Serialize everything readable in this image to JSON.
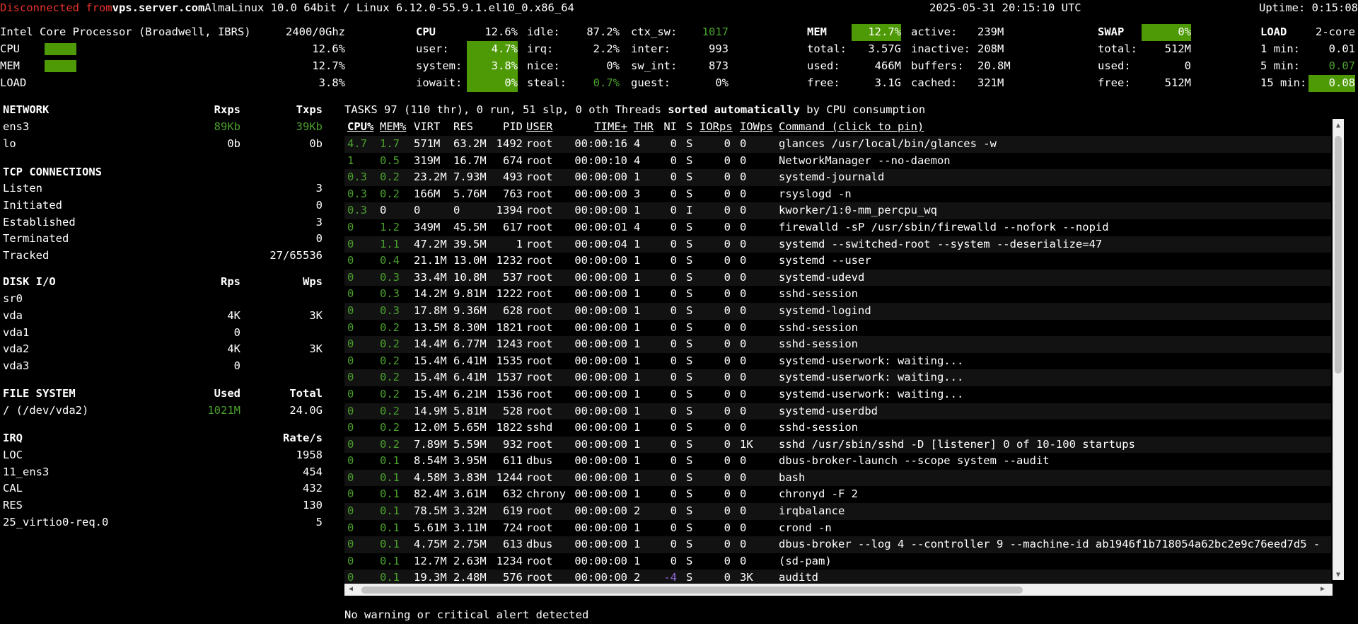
{
  "colors": {
    "accent_green": "#4e9a06",
    "text_green": "#4aa02c",
    "warn_red": "#e8342b",
    "nice_purple": "#8d6bd6",
    "background": "#000000"
  },
  "header": {
    "disconnected": "Disconnected from",
    "host": "vps.server.com",
    "os": "AlmaLinux 10.0 64bit / Linux 6.12.0-55.9.1.el10_0.x86_64",
    "datetime": "2025-05-31 20:15:10 UTC",
    "uptime": "Uptime: 0:15:08"
  },
  "quicklook": {
    "cpu_name": "Intel Core Processor (Broadwell, IBRS)",
    "freq": "2400/0Ghz",
    "cpu_label": "CPU",
    "cpu_pct": "12.6%",
    "cpu_fill": 0.126,
    "mem_label": "MEM",
    "mem_pct": "12.7%",
    "mem_fill": 0.127,
    "load_label": "LOAD",
    "load_pct": "3.8%"
  },
  "cpu": {
    "title": "CPU",
    "total": "12.6%",
    "user_l": "user:",
    "user": "4.7%",
    "system_l": "system:",
    "system": "3.8%",
    "iowait_l": "iowait:",
    "iowait": "0%",
    "idle_l": "idle:",
    "idle": "87.2%",
    "irq_l": "irq:",
    "irq": "2.2%",
    "nice_l": "nice:",
    "nice": "0%",
    "steal_l": "steal:",
    "steal": "0.7%",
    "ctx_l": "ctx_sw:",
    "ctx": "1017",
    "inter_l": "inter:",
    "inter": "993",
    "swint_l": "sw_int:",
    "swint": "873",
    "guest_l": "guest:",
    "guest": "0%"
  },
  "mem": {
    "title": "MEM",
    "pct": "12.7%",
    "total_l": "total:",
    "total": "3.57G",
    "used_l": "used:",
    "used": "466M",
    "free_l": "free:",
    "free": "3.1G",
    "active_l": "active:",
    "active": "239M",
    "inactive_l": "inactive:",
    "inactive": "208M",
    "buffers_l": "buffers:",
    "buffers": "20.8M",
    "cached_l": "cached:",
    "cached": "321M"
  },
  "swap": {
    "title": "SWAP",
    "pct": "0%",
    "total_l": "total:",
    "total": "512M",
    "used_l": "used:",
    "used": "0",
    "free_l": "free:",
    "free": "512M"
  },
  "load": {
    "title": "LOAD",
    "cores": "2-core",
    "m1_l": "1 min:",
    "m1": "0.01",
    "m5_l": "5 min:",
    "m5": "0.07",
    "m15_l": "15 min:",
    "m15": "0.08"
  },
  "network": {
    "title": "NETWORK",
    "rx": "Rxps",
    "tx": "Txps",
    "rows": [
      {
        "name": "ens3",
        "rx": "89Kb",
        "tx": "39Kb"
      },
      {
        "name": "lo",
        "rx": "0b",
        "tx": "0b"
      }
    ]
  },
  "tcp": {
    "title": "TCP CONNECTIONS",
    "rows": [
      {
        "name": "Listen",
        "value": "3"
      },
      {
        "name": "Initiated",
        "value": "0"
      },
      {
        "name": "Established",
        "value": "3"
      },
      {
        "name": "Terminated",
        "value": "0"
      },
      {
        "name": "Tracked",
        "value": "27/65536"
      }
    ]
  },
  "diskio": {
    "title": "DISK I/O",
    "rps": "Rps",
    "wps": "Wps",
    "rows": [
      {
        "name": "sr0",
        "r": "",
        "w": ""
      },
      {
        "name": "vda",
        "r": "4K",
        "w": "3K"
      },
      {
        "name": "vda1",
        "r": "0",
        "w": ""
      },
      {
        "name": "vda2",
        "r": "4K",
        "w": "3K"
      },
      {
        "name": "vda3",
        "r": "0",
        "w": ""
      }
    ]
  },
  "fs": {
    "title": "FILE SYSTEM",
    "used": "Used",
    "total": "Total",
    "rows": [
      {
        "name": "/ (/dev/vda2)",
        "used": "1021M",
        "total": "24.0G"
      }
    ]
  },
  "irq": {
    "title": "IRQ",
    "rate": "Rate/s",
    "rows": [
      {
        "name": "LOC",
        "value": "1958"
      },
      {
        "name": "11_ens3",
        "value": "454"
      },
      {
        "name": "CAL",
        "value": "432"
      },
      {
        "name": "RES",
        "value": "130"
      },
      {
        "name": "25_virtio0-req.0",
        "value": "5"
      }
    ]
  },
  "tasks": {
    "prefix": "TASKS 97 (110 thr), 0 run, 51 slp, 0 oth Threads ",
    "sorted": "sorted automatically",
    "suffix": " by CPU consumption"
  },
  "proc_headers": {
    "cpu": "CPU%",
    "mem": "MEM%",
    "virt": "VIRT",
    "res": "RES",
    "pid": "PID",
    "user": "USER",
    "time": "TIME+",
    "thr": "THR",
    "ni": "NI",
    "s": "S",
    "ior": "IORps",
    "iow": "IOWps",
    "cmd": "Command (click to pin)"
  },
  "processes": [
    {
      "cpu": "4.7",
      "mem": "1.7",
      "virt": "571M",
      "res": "63.2M",
      "pid": "1492",
      "user": "root",
      "time": "00:00:16",
      "thr": "4",
      "ni": "0",
      "s": "S",
      "ior": "0",
      "iow": "0",
      "cmd": "glances /usr/local/bin/glances -w"
    },
    {
      "cpu": "1",
      "mem": "0.5",
      "virt": "319M",
      "res": "16.7M",
      "pid": "674",
      "user": "root",
      "time": "00:00:10",
      "thr": "4",
      "ni": "0",
      "s": "S",
      "ior": "0",
      "iow": "0",
      "cmd": "NetworkManager --no-daemon"
    },
    {
      "cpu": "0.3",
      "mem": "0.2",
      "virt": "23.2M",
      "res": "7.93M",
      "pid": "493",
      "user": "root",
      "time": "00:00:00",
      "thr": "1",
      "ni": "0",
      "s": "S",
      "ior": "0",
      "iow": "0",
      "cmd": "systemd-journald"
    },
    {
      "cpu": "0.3",
      "mem": "0.2",
      "virt": "166M",
      "res": "5.76M",
      "pid": "763",
      "user": "root",
      "time": "00:00:00",
      "thr": "3",
      "ni": "0",
      "s": "S",
      "ior": "0",
      "iow": "0",
      "cmd": "rsyslogd -n"
    },
    {
      "cpu": "0.3",
      "mem": "0",
      "virt": "0",
      "res": "0",
      "pid": "1394",
      "user": "root",
      "time": "00:00:00",
      "thr": "1",
      "ni": "0",
      "s": "I",
      "ior": "0",
      "iow": "0",
      "cmd": "kworker/1:0-mm_percpu_wq"
    },
    {
      "cpu": "0",
      "mem": "1.2",
      "virt": "349M",
      "res": "45.5M",
      "pid": "617",
      "user": "root",
      "time": "00:00:01",
      "thr": "4",
      "ni": "0",
      "s": "S",
      "ior": "0",
      "iow": "0",
      "cmd": "firewalld -sP /usr/sbin/firewalld --nofork --nopid"
    },
    {
      "cpu": "0",
      "mem": "1.1",
      "virt": "47.2M",
      "res": "39.5M",
      "pid": "1",
      "user": "root",
      "time": "00:00:04",
      "thr": "1",
      "ni": "0",
      "s": "S",
      "ior": "0",
      "iow": "0",
      "cmd": "systemd --switched-root --system --deserialize=47"
    },
    {
      "cpu": "0",
      "mem": "0.4",
      "virt": "21.1M",
      "res": "13.0M",
      "pid": "1232",
      "user": "root",
      "time": "00:00:00",
      "thr": "1",
      "ni": "0",
      "s": "S",
      "ior": "0",
      "iow": "0",
      "cmd": "systemd --user"
    },
    {
      "cpu": "0",
      "mem": "0.3",
      "virt": "33.4M",
      "res": "10.8M",
      "pid": "537",
      "user": "root",
      "time": "00:00:00",
      "thr": "1",
      "ni": "0",
      "s": "S",
      "ior": "0",
      "iow": "0",
      "cmd": "systemd-udevd"
    },
    {
      "cpu": "0",
      "mem": "0.3",
      "virt": "14.2M",
      "res": "9.81M",
      "pid": "1222",
      "user": "root",
      "time": "00:00:00",
      "thr": "1",
      "ni": "0",
      "s": "S",
      "ior": "0",
      "iow": "0",
      "cmd": "sshd-session"
    },
    {
      "cpu": "0",
      "mem": "0.3",
      "virt": "17.8M",
      "res": "9.36M",
      "pid": "628",
      "user": "root",
      "time": "00:00:00",
      "thr": "1",
      "ni": "0",
      "s": "S",
      "ior": "0",
      "iow": "0",
      "cmd": "systemd-logind"
    },
    {
      "cpu": "0",
      "mem": "0.2",
      "virt": "13.5M",
      "res": "8.30M",
      "pid": "1821",
      "user": "root",
      "time": "00:00:00",
      "thr": "1",
      "ni": "0",
      "s": "S",
      "ior": "0",
      "iow": "0",
      "cmd": "sshd-session"
    },
    {
      "cpu": "0",
      "mem": "0.2",
      "virt": "14.4M",
      "res": "6.77M",
      "pid": "1243",
      "user": "root",
      "time": "00:00:00",
      "thr": "1",
      "ni": "0",
      "s": "S",
      "ior": "0",
      "iow": "0",
      "cmd": "sshd-session"
    },
    {
      "cpu": "0",
      "mem": "0.2",
      "virt": "15.4M",
      "res": "6.41M",
      "pid": "1535",
      "user": "root",
      "time": "00:00:00",
      "thr": "1",
      "ni": "0",
      "s": "S",
      "ior": "0",
      "iow": "0",
      "cmd": "systemd-userwork: waiting..."
    },
    {
      "cpu": "0",
      "mem": "0.2",
      "virt": "15.4M",
      "res": "6.41M",
      "pid": "1537",
      "user": "root",
      "time": "00:00:00",
      "thr": "1",
      "ni": "0",
      "s": "S",
      "ior": "0",
      "iow": "0",
      "cmd": "systemd-userwork: waiting..."
    },
    {
      "cpu": "0",
      "mem": "0.2",
      "virt": "15.4M",
      "res": "6.21M",
      "pid": "1536",
      "user": "root",
      "time": "00:00:00",
      "thr": "1",
      "ni": "0",
      "s": "S",
      "ior": "0",
      "iow": "0",
      "cmd": "systemd-userwork: waiting..."
    },
    {
      "cpu": "0",
      "mem": "0.2",
      "virt": "14.9M",
      "res": "5.81M",
      "pid": "528",
      "user": "root",
      "time": "00:00:00",
      "thr": "1",
      "ni": "0",
      "s": "S",
      "ior": "0",
      "iow": "0",
      "cmd": "systemd-userdbd"
    },
    {
      "cpu": "0",
      "mem": "0.2",
      "virt": "12.0M",
      "res": "5.65M",
      "pid": "1822",
      "user": "sshd",
      "time": "00:00:00",
      "thr": "1",
      "ni": "0",
      "s": "S",
      "ior": "0",
      "iow": "0",
      "cmd": "sshd-session"
    },
    {
      "cpu": "0",
      "mem": "0.2",
      "virt": "7.89M",
      "res": "5.59M",
      "pid": "932",
      "user": "root",
      "time": "00:00:00",
      "thr": "1",
      "ni": "0",
      "s": "S",
      "ior": "0",
      "iow": "1K",
      "cmd": "sshd /usr/sbin/sshd -D [listener] 0 of 10-100 startups"
    },
    {
      "cpu": "0",
      "mem": "0.1",
      "virt": "8.54M",
      "res": "3.95M",
      "pid": "611",
      "user": "dbus",
      "time": "00:00:00",
      "thr": "1",
      "ni": "0",
      "s": "S",
      "ior": "0",
      "iow": "0",
      "cmd": "dbus-broker-launch --scope system --audit"
    },
    {
      "cpu": "0",
      "mem": "0.1",
      "virt": "4.58M",
      "res": "3.83M",
      "pid": "1244",
      "user": "root",
      "time": "00:00:00",
      "thr": "1",
      "ni": "0",
      "s": "S",
      "ior": "0",
      "iow": "0",
      "cmd": "bash"
    },
    {
      "cpu": "0",
      "mem": "0.1",
      "virt": "82.4M",
      "res": "3.61M",
      "pid": "632",
      "user": "chrony",
      "time": "00:00:00",
      "thr": "1",
      "ni": "0",
      "s": "S",
      "ior": "0",
      "iow": "0",
      "cmd": "chronyd -F 2"
    },
    {
      "cpu": "0",
      "mem": "0.1",
      "virt": "78.5M",
      "res": "3.32M",
      "pid": "619",
      "user": "root",
      "time": "00:00:00",
      "thr": "2",
      "ni": "0",
      "s": "S",
      "ior": "0",
      "iow": "0",
      "cmd": "irqbalance"
    },
    {
      "cpu": "0",
      "mem": "0.1",
      "virt": "5.61M",
      "res": "3.11M",
      "pid": "724",
      "user": "root",
      "time": "00:00:00",
      "thr": "1",
      "ni": "0",
      "s": "S",
      "ior": "0",
      "iow": "0",
      "cmd": "crond -n"
    },
    {
      "cpu": "0",
      "mem": "0.1",
      "virt": "4.75M",
      "res": "2.75M",
      "pid": "613",
      "user": "dbus",
      "time": "00:00:00",
      "thr": "1",
      "ni": "0",
      "s": "S",
      "ior": "0",
      "iow": "0",
      "cmd": "dbus-broker --log 4 --controller 9 --machine-id ab1946f1b718054a62bc2e9c76eed7d5 -"
    },
    {
      "cpu": "0",
      "mem": "0.1",
      "virt": "12.7M",
      "res": "2.63M",
      "pid": "1234",
      "user": "root",
      "time": "00:00:00",
      "thr": "1",
      "ni": "0",
      "s": "S",
      "ior": "0",
      "iow": "0",
      "cmd": "(sd-pam)"
    },
    {
      "cpu": "0",
      "mem": "0.1",
      "virt": "19.3M",
      "res": "2.48M",
      "pid": "576",
      "user": "root",
      "time": "00:00:00",
      "thr": "2",
      "ni": "-4",
      "s": "S",
      "ior": "0",
      "iow": "3K",
      "cmd": "auditd"
    }
  ],
  "footer": {
    "alert": "No warning or critical alert detected"
  }
}
